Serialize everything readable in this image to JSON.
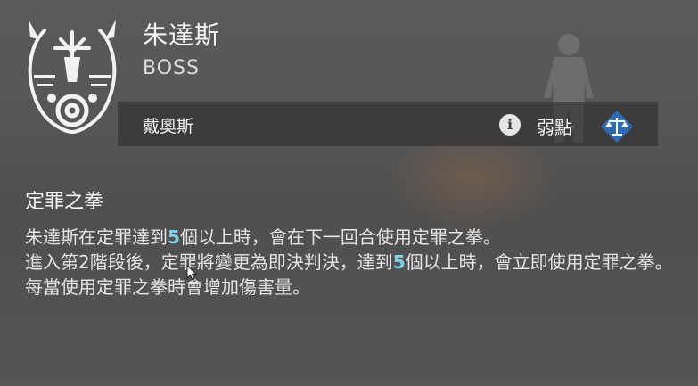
{
  "boss": {
    "name": "朱達斯",
    "rank": "BOSS",
    "emblem_icon": "judas-emblem-icon"
  },
  "info_bar": {
    "sub_name": "戴奧斯",
    "info_icon": "info-icon",
    "info_glyph": "i",
    "weakness_label": "弱點",
    "weakness_icon": "scales-icon"
  },
  "skill": {
    "title": "定罪之拳",
    "lines": [
      {
        "before": "朱達斯在定罪達到",
        "num": "5",
        "after": "個以上時，會在下一回合使用定罪之拳。"
      },
      {
        "before": "進入第2階段後，定罪將變更為即決判決，達到",
        "num": "5",
        "after": "個以上時，會立即使用定罪之拳。"
      },
      {
        "before": "每當使用定罪之拳時會增加傷害量。",
        "num": "",
        "after": ""
      }
    ]
  },
  "colors": {
    "highlight": "#7fd0ea",
    "weakness_badge": "#2f6db3"
  }
}
